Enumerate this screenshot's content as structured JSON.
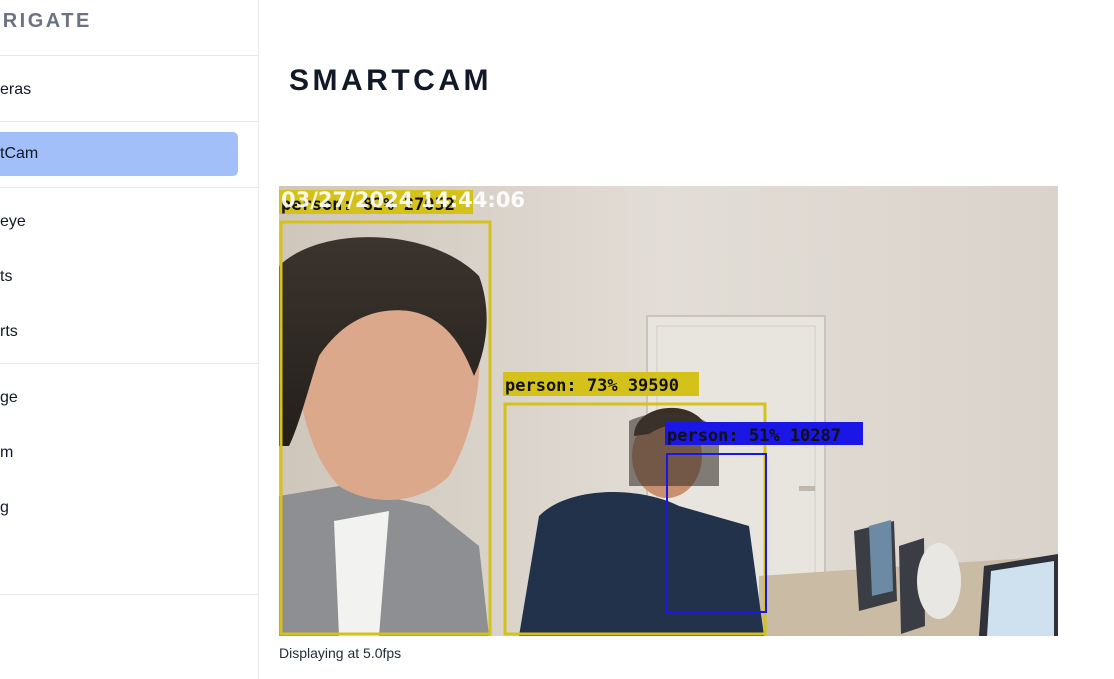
{
  "app": {
    "brand": "FRIGATE"
  },
  "sidebar": {
    "items": [
      {
        "label": "eras",
        "active": false
      },
      {
        "label": "tCam",
        "active": true
      },
      {
        "label": "eye",
        "active": false
      },
      {
        "label": "ts",
        "active": false
      },
      {
        "label": "rts",
        "active": false
      },
      {
        "label": "ge",
        "active": false
      },
      {
        "label": "m",
        "active": false
      },
      {
        "label": "g",
        "active": false
      }
    ]
  },
  "main": {
    "title": "SMARTCAM",
    "feed": {
      "timestamp": "03/27/2024 14:44:06",
      "overlay_partial_label": "person: 82% 27052",
      "detections": [
        {
          "label": "person: 73% 39590",
          "color": "#d4c21a"
        },
        {
          "label": "person: 51% 10287",
          "color": "#1a16e6"
        }
      ]
    },
    "fps_label": "Displaying at 5.0fps"
  },
  "colors": {
    "active_nav_bg": "#a3bffa",
    "detection_yellow": "#d4c21a",
    "detection_blue": "#1a16e6",
    "brand_text": "#6b7280"
  }
}
